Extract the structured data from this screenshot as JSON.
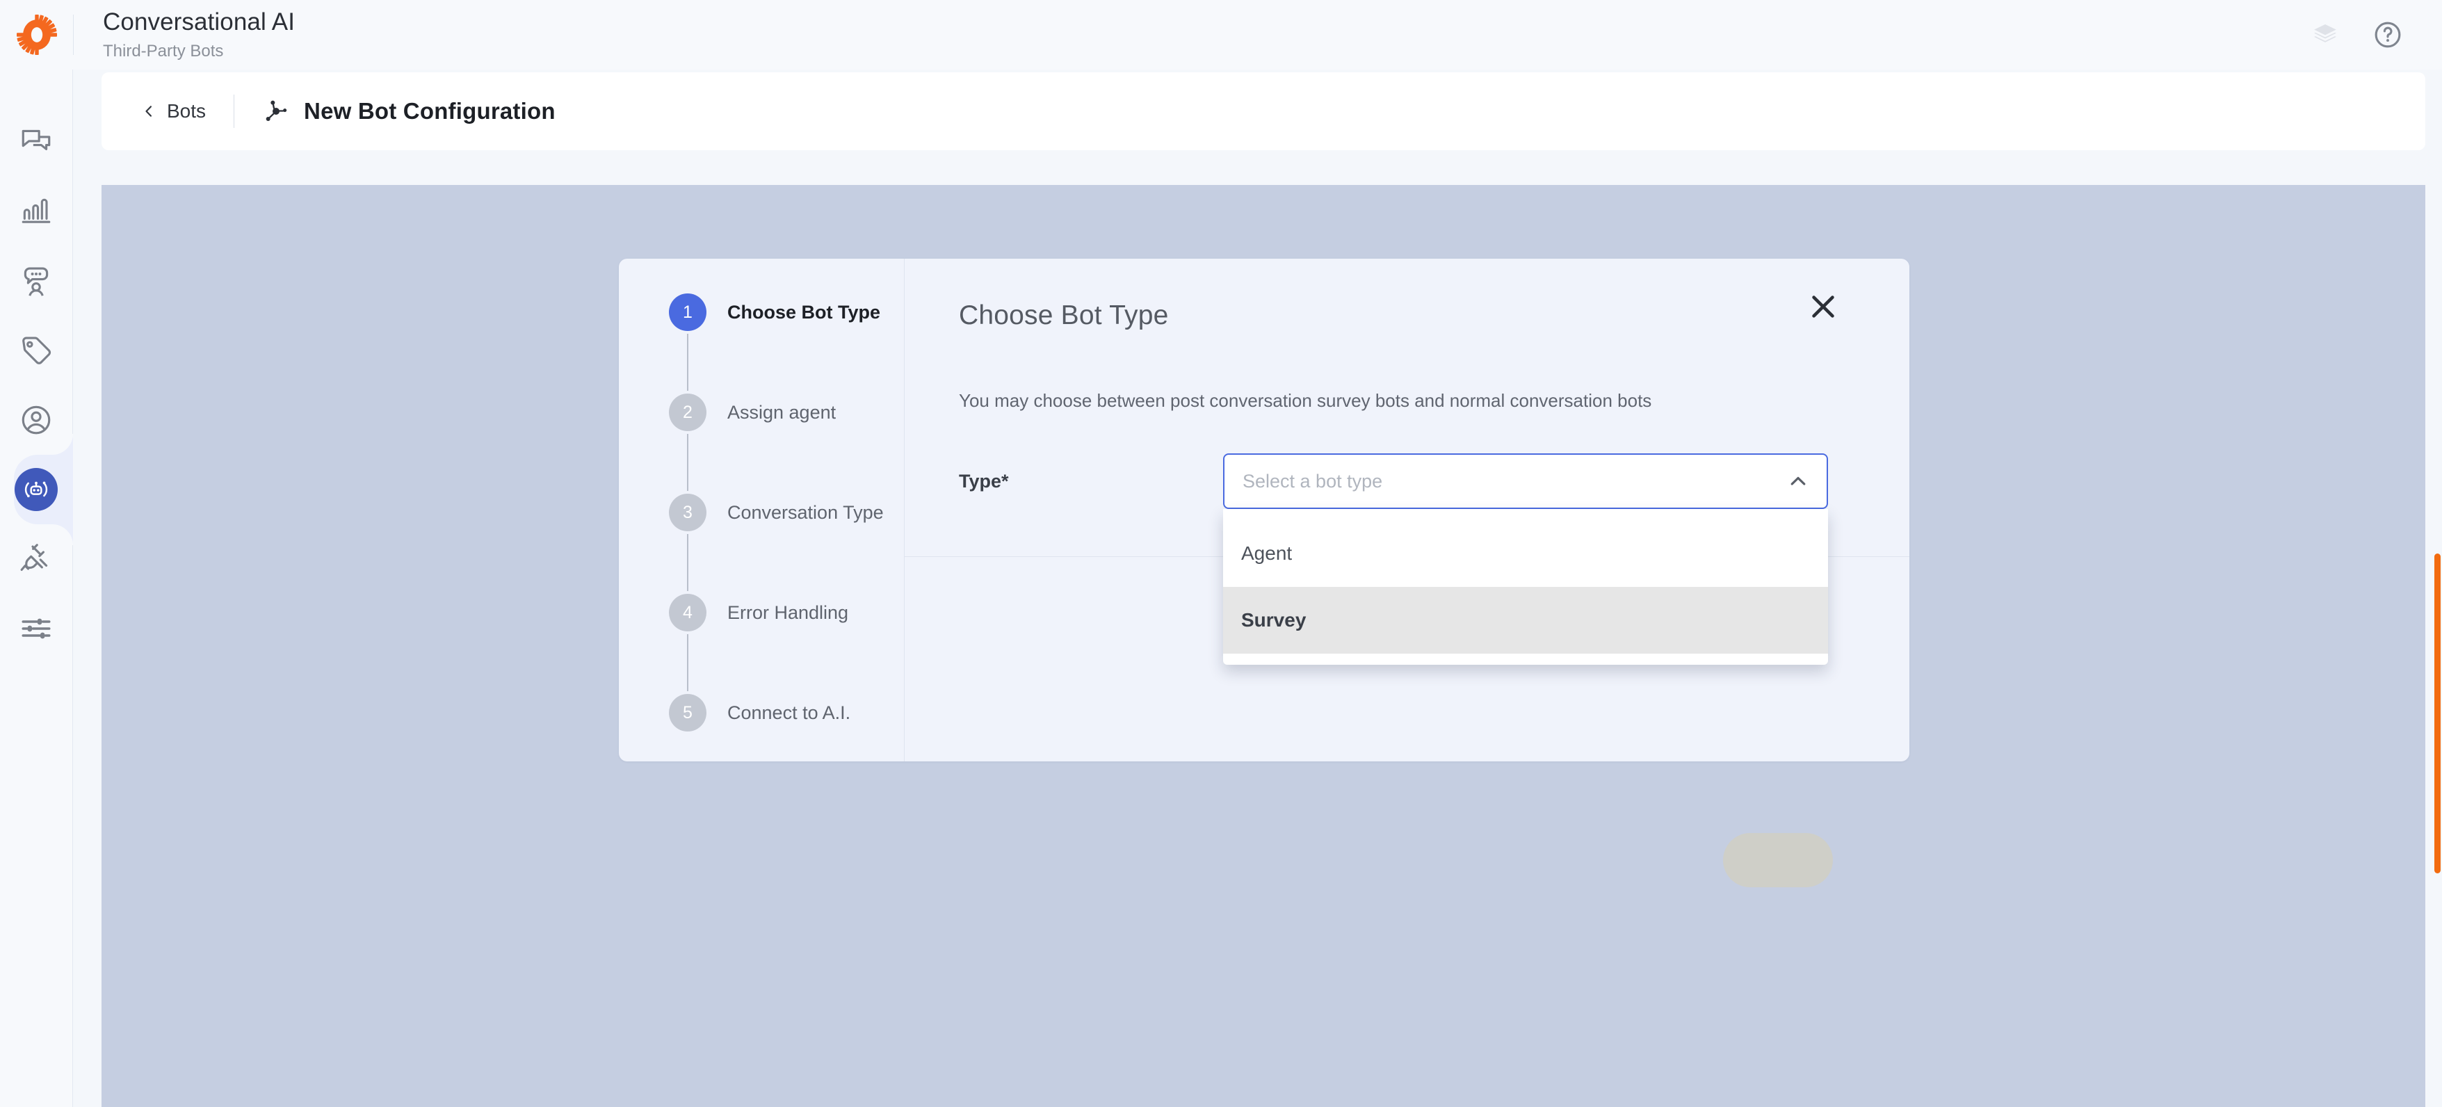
{
  "header": {
    "logo_icon": "gear-icon",
    "title": "Conversational AI",
    "subtitle": "Third-Party Bots",
    "actions": [
      {
        "icon": "layers-icon",
        "name": "layers-button"
      },
      {
        "icon": "help-circle-icon",
        "name": "help-button"
      }
    ]
  },
  "rail": {
    "items": [
      {
        "icon": "chat-bubbles-icon",
        "name": "sidebar-item-conversations",
        "active": false
      },
      {
        "icon": "bar-chart-icon",
        "name": "sidebar-item-analytics",
        "active": false
      },
      {
        "icon": "agent-speech-icon",
        "name": "sidebar-item-agents",
        "active": false
      },
      {
        "icon": "tag-icon",
        "name": "sidebar-item-tags",
        "active": false
      },
      {
        "icon": "user-circle-icon",
        "name": "sidebar-item-users",
        "active": false
      },
      {
        "icon": "bot-icon",
        "name": "sidebar-item-bots",
        "active": true
      },
      {
        "icon": "plug-icon",
        "name": "sidebar-item-integrations",
        "active": false
      },
      {
        "icon": "sliders-icon",
        "name": "sidebar-item-settings",
        "active": false
      }
    ]
  },
  "breadcrumb": {
    "back_label": "Bots",
    "back_icon": "chevron-left-icon",
    "page_icon": "bot-node-icon",
    "page_title": "New Bot Configuration"
  },
  "wizard": {
    "steps": [
      {
        "number": "1",
        "label": "Choose Bot Type",
        "active": true
      },
      {
        "number": "2",
        "label": "Assign agent",
        "active": false
      },
      {
        "number": "3",
        "label": "Conversation Type",
        "active": false
      },
      {
        "number": "4",
        "label": "Error Handling",
        "active": false
      },
      {
        "number": "5",
        "label": "Connect to A.I.",
        "active": false
      }
    ],
    "panel": {
      "title": "Choose Bot Type",
      "description": "You may choose between post conversation survey bots and normal conversation bots",
      "close_icon": "close-icon",
      "field": {
        "label": "Type*",
        "placeholder": "Select a bot type",
        "value": "",
        "chevron_icon": "chevron-up-icon",
        "expanded": true,
        "options": [
          {
            "label": "Agent",
            "highlighted": false
          },
          {
            "label": "Survey",
            "highlighted": true
          }
        ]
      },
      "next_button_label": ""
    }
  },
  "colors": {
    "accent_blue": "#4a6ae0",
    "brand_orange": "#f26b0f",
    "canvas": "#c5cee1",
    "card": "#f0f3fb"
  }
}
